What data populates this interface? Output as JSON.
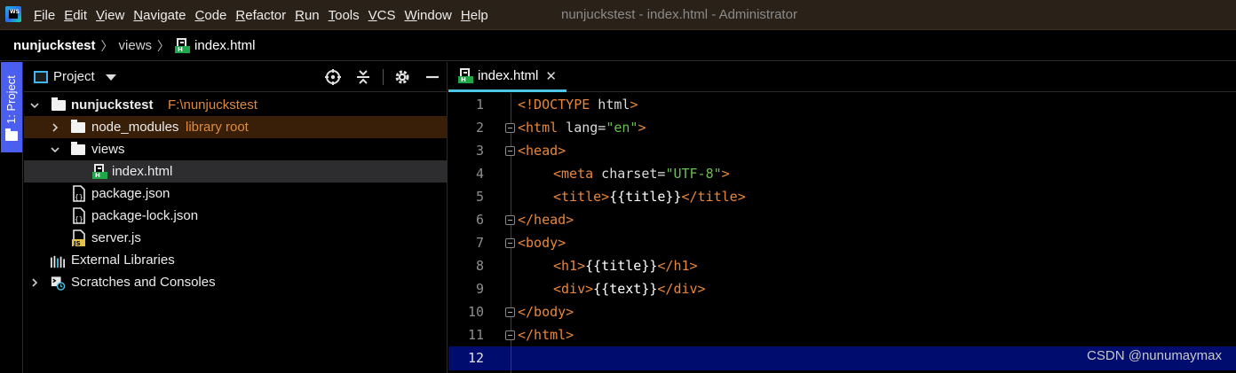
{
  "menubar": {
    "items": [
      "File",
      "Edit",
      "View",
      "Navigate",
      "Code",
      "Refactor",
      "Run",
      "Tools",
      "VCS",
      "Window",
      "Help"
    ],
    "window_title": "nunjuckstest - index.html - Administrator"
  },
  "breadcrumb": {
    "project": "nunjuckstest",
    "folder": "views",
    "file": "index.html"
  },
  "tool_strip": {
    "project_tab": "1: Project"
  },
  "project_panel": {
    "title": "Project",
    "tree": [
      {
        "label": "nunjuckstest",
        "hint": "F:\\nunjuckstest",
        "icon": "folder-icon",
        "expanded": true
      },
      {
        "label": "node_modules",
        "hint": "library root",
        "icon": "folder-icon",
        "expanded": false
      },
      {
        "label": "views",
        "icon": "folder-icon",
        "expanded": true
      },
      {
        "label": "index.html",
        "icon": "html-file-icon"
      },
      {
        "label": "package.json",
        "icon": "json-file-icon"
      },
      {
        "label": "package-lock.json",
        "icon": "json-file-icon"
      },
      {
        "label": "server.js",
        "icon": "js-file-icon"
      },
      {
        "label": "External Libraries",
        "icon": "library-icon"
      },
      {
        "label": "Scratches and Consoles",
        "icon": "scratches-icon",
        "expanded": false
      }
    ]
  },
  "editor": {
    "tab_label": "index.html",
    "line_numbers": [
      "1",
      "2",
      "3",
      "4",
      "5",
      "6",
      "7",
      "8",
      "9",
      "10",
      "11",
      "12"
    ],
    "code": {
      "l1_tag": "<!DOCTYPE",
      "l1_attr": " html",
      "l1_close": ">",
      "l2_open": "<html",
      "l2_attr": " lang=",
      "l2_str": "\"en\"",
      "l2_close": ">",
      "l3": "<head>",
      "l4_open": "<meta",
      "l4_attr": " charset=",
      "l4_str": "\"UTF-8\"",
      "l4_close": ">",
      "l5_open": "<title>",
      "l5_txt": "{{title}}",
      "l5_close": "</title>",
      "l6": "</head>",
      "l7": "<body>",
      "l8_open": "<h1>",
      "l8_txt": "{{title}}",
      "l8_close": "</h1>",
      "l9_open": "<div>",
      "l9_txt": "{{text}}",
      "l9_close": "</div>",
      "l10": "</body>",
      "l11": "</html>"
    }
  },
  "watermark": "CSDN @nunumaymax",
  "colors": {
    "menubar_bg": "#2a2218",
    "tool_tab": "#4a5ef0",
    "selection_row": "#2d2d30",
    "library_row": "#3a1f08",
    "tag": "#e8873a",
    "string": "#6dbf53",
    "current_line": "#000d6e",
    "tab_underline": "#4ac6e6"
  }
}
